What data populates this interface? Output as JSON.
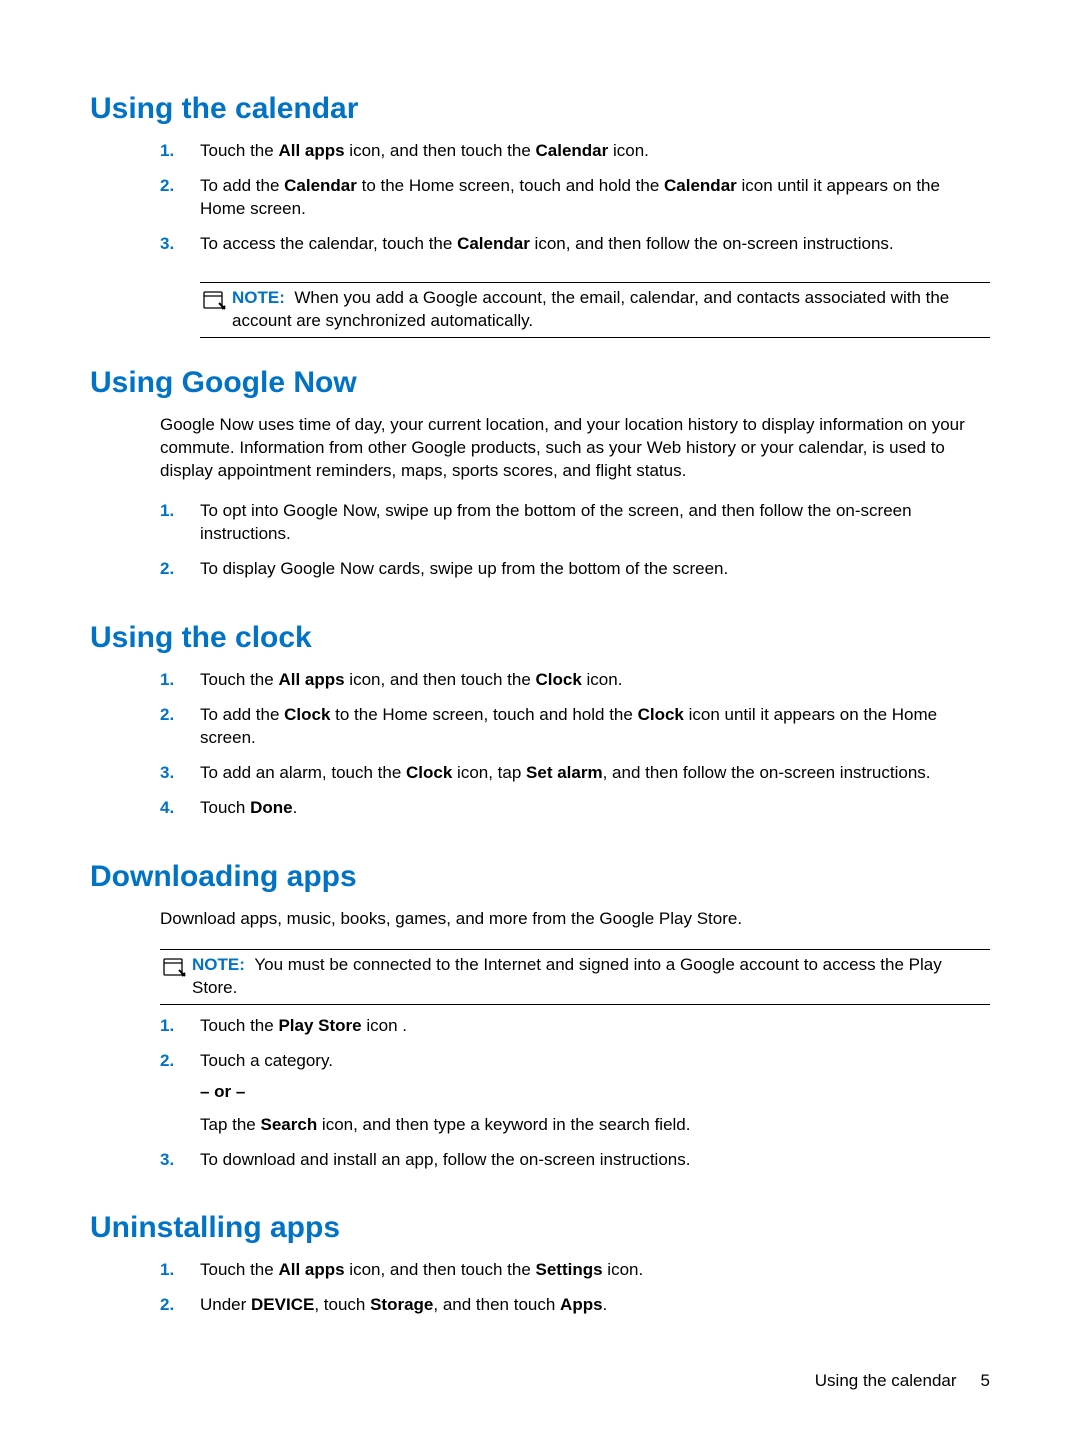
{
  "sections": {
    "calendar": {
      "heading": "Using the calendar",
      "step1": {
        "pre": "Touch the ",
        "b1": "All apps",
        "mid": " icon, and then touch the ",
        "b2": "Calendar",
        "post": " icon."
      },
      "step2": {
        "pre": "To add the ",
        "b1": "Calendar",
        "mid": " to the Home screen, touch and hold the ",
        "b2": "Calendar",
        "post": " icon until it appears on the Home screen."
      },
      "step3": {
        "pre": "To access the calendar, touch the ",
        "b1": "Calendar",
        "post": " icon, and then follow the on-screen instructions."
      },
      "note": {
        "label": "NOTE:",
        "text": "When you add a Google account, the email, calendar, and contacts associated with the account are synchronized automatically."
      }
    },
    "gnow": {
      "heading": "Using Google Now",
      "intro": "Google Now uses time of day, your current location, and your location history to display information on your commute. Information from other Google products, such as your Web history or your calendar, is used to display appointment reminders, maps, sports scores, and flight status.",
      "step1": "To opt into Google Now, swipe up from the bottom of the screen, and then follow the on-screen instructions.",
      "step2": "To display Google Now cards, swipe up from the bottom of the screen."
    },
    "clock": {
      "heading": "Using the clock",
      "step1": {
        "pre": "Touch the ",
        "b1": "All apps",
        "mid": " icon, and then touch the ",
        "b2": "Clock",
        "post": " icon."
      },
      "step2": {
        "pre": "To add the ",
        "b1": "Clock",
        "mid": " to the Home screen, touch and hold the ",
        "b2": "Clock",
        "post": " icon until it appears on the Home screen."
      },
      "step3": {
        "pre": "To add an alarm, touch the ",
        "b1": "Clock",
        "mid": " icon, tap ",
        "b2": "Set alarm",
        "post": ", and then follow the on-screen instructions."
      },
      "step4": {
        "pre": "Touch ",
        "b1": "Done",
        "post": "."
      }
    },
    "download": {
      "heading": "Downloading apps",
      "intro": "Download apps, music, books, games, and more from the Google Play Store.",
      "note": {
        "label": "NOTE:",
        "text": "You must be connected to the Internet and signed into a Google account to access the Play Store."
      },
      "step1": {
        "pre": "Touch the ",
        "b1": "Play Store",
        "post": " icon ."
      },
      "step2": {
        "main": "Touch a category.",
        "or": "– or –",
        "sub_pre": "Tap the ",
        "sub_b": "Search",
        "sub_post": " icon, and then type a keyword in the search field."
      },
      "step3": "To download and install an app, follow the on-screen instructions."
    },
    "uninstall": {
      "heading": "Uninstalling apps",
      "step1": {
        "pre": "Touch the ",
        "b1": "All apps",
        "mid": " icon, and then touch the ",
        "b2": "Settings",
        "post": " icon."
      },
      "step2": {
        "pre": "Under ",
        "b1": "DEVICE",
        "mid": ", touch ",
        "b2": "Storage",
        "mid2": ", and then touch ",
        "b3": "Apps",
        "post": "."
      }
    }
  },
  "footer": {
    "title": "Using the calendar",
    "page": "5"
  }
}
